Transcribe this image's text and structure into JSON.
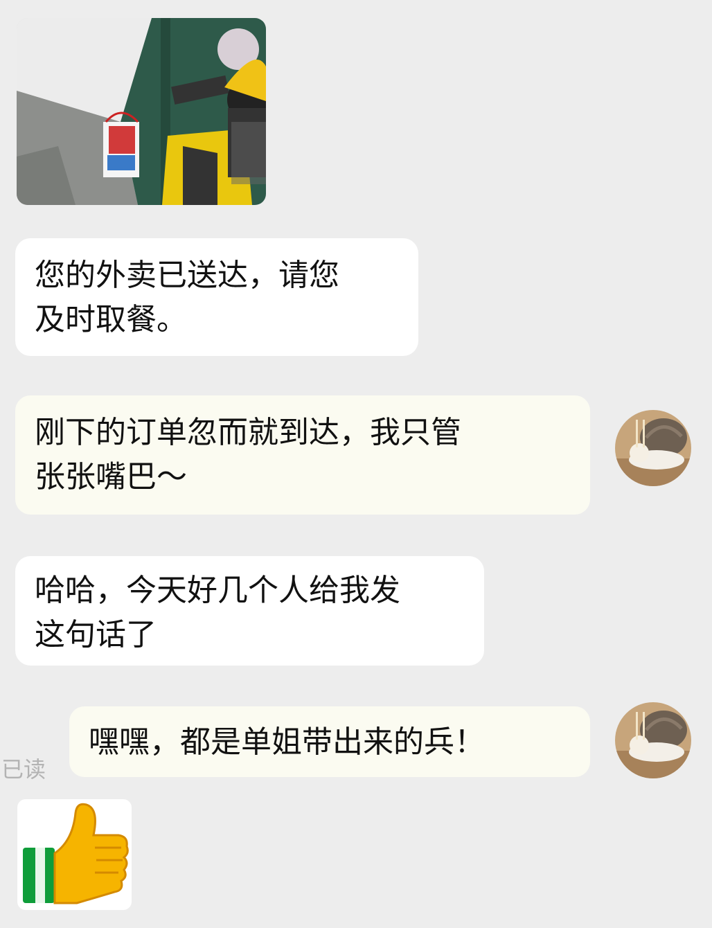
{
  "messages": [
    {
      "id": "m1",
      "side": "left",
      "type": "image",
      "icon": "delivery-photo"
    },
    {
      "id": "m2",
      "side": "left",
      "type": "text",
      "text": "您的外卖已送达，请您\n及时取餐。"
    },
    {
      "id": "m3",
      "side": "right",
      "type": "text",
      "text": "刚下的订单忽而就到达，我只管\n张张嘴巴～"
    },
    {
      "id": "m4",
      "side": "left",
      "type": "text",
      "text": "哈哈，今天好几个人给我发\n这句话了"
    },
    {
      "id": "m5",
      "side": "right",
      "type": "text",
      "text": "嘿嘿，都是单姐带出来的兵！",
      "status": "已读"
    },
    {
      "id": "m6",
      "side": "left",
      "type": "sticker",
      "icon": "thumbs-up-icon"
    }
  ],
  "colors": {
    "background": "#ededed",
    "left_bubble": "#ffffff",
    "right_bubble": "#fbfbf1",
    "status_text": "#b3b3b3"
  }
}
